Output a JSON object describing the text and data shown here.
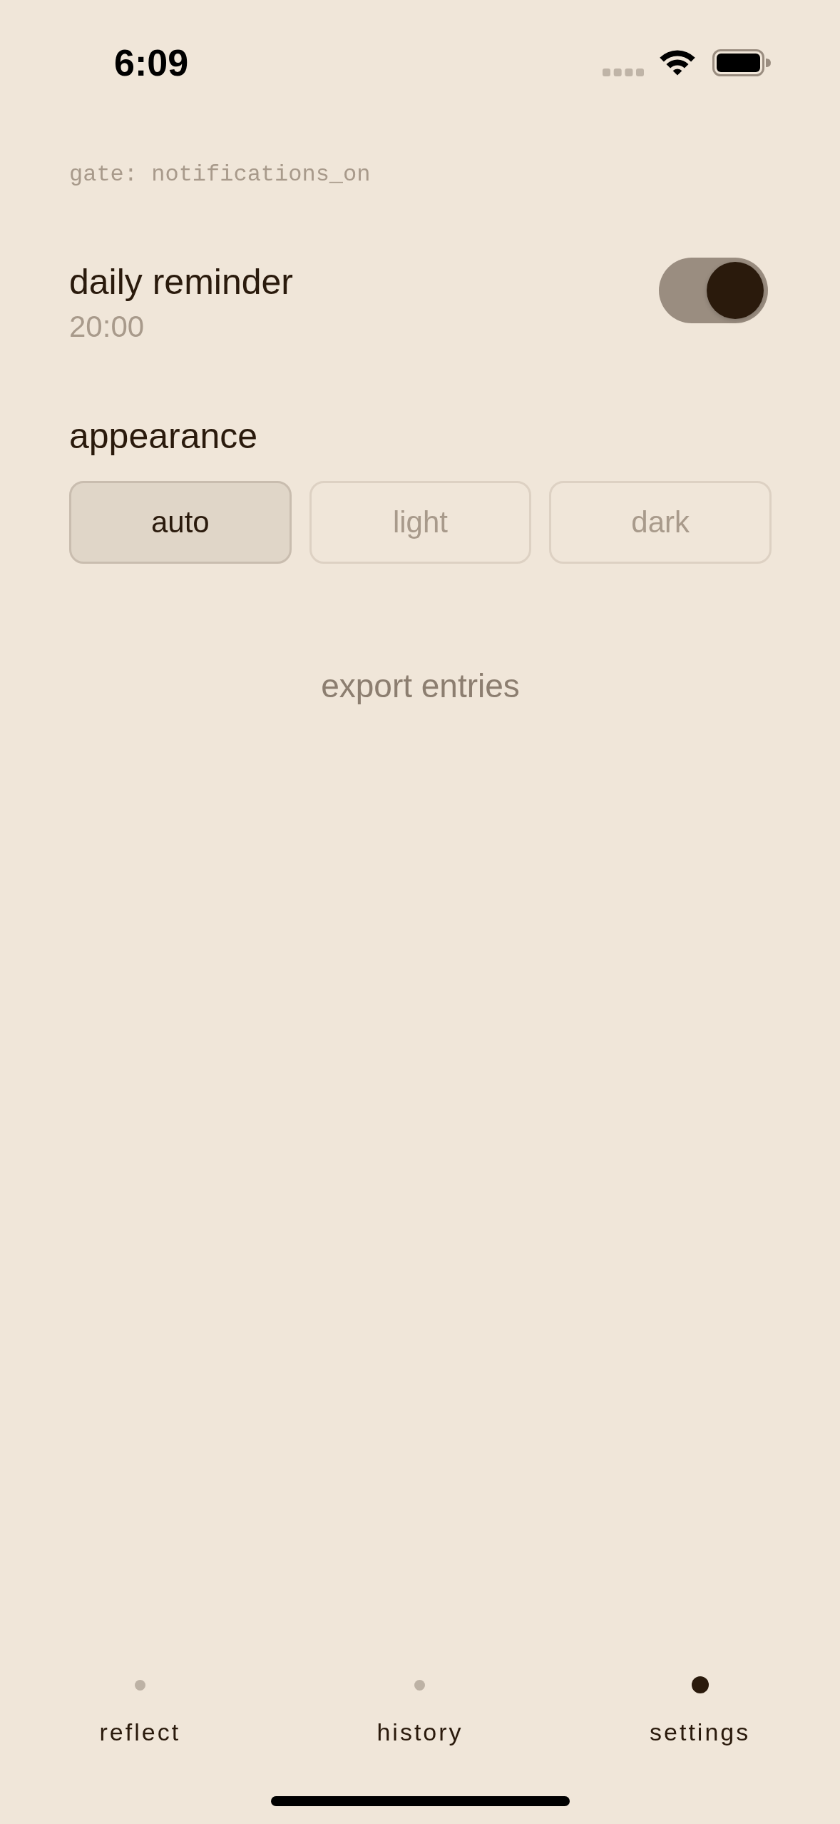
{
  "status_bar": {
    "time": "6:09"
  },
  "gate_label": "gate: notifications_on",
  "reminder": {
    "title": "daily reminder",
    "time": "20:00",
    "on": true
  },
  "appearance": {
    "title": "appearance",
    "options": [
      {
        "label": "auto",
        "selected": true
      },
      {
        "label": "light",
        "selected": false
      },
      {
        "label": "dark",
        "selected": false
      }
    ]
  },
  "export_button": {
    "label": "export entries"
  },
  "tab_bar": {
    "tabs": [
      {
        "label": "reflect",
        "selected": false
      },
      {
        "label": "history",
        "selected": false
      },
      {
        "label": "settings",
        "selected": true
      }
    ]
  }
}
